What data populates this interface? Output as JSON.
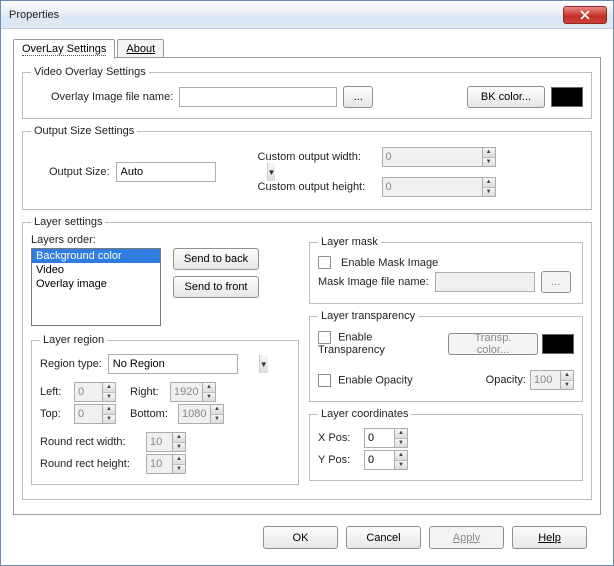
{
  "window": {
    "title": "Properties"
  },
  "tabs": {
    "overlay": "OverLay Settings",
    "about": "About"
  },
  "video_overlay": {
    "legend": "Video Overlay Settings",
    "file_label": "Overlay Image file name:",
    "file_value": "",
    "browse": "...",
    "bk_color": "BK color...",
    "bk_color_value": "#000000"
  },
  "output_size": {
    "legend": "Output Size Settings",
    "size_label": "Output Size:",
    "size_value": "Auto",
    "cw_label": "Custom output width:",
    "cw_value": "0",
    "ch_label": "Custom output height:",
    "ch_value": "0"
  },
  "layer_settings": {
    "legend": "Layer settings",
    "order_label": "Layers order:",
    "items": [
      "Background color",
      "Video",
      "Overlay image"
    ],
    "selected_index": 0,
    "send_back": "Send to back",
    "send_front": "Send to front"
  },
  "layer_mask": {
    "legend": "Layer mask",
    "enable": "Enable Mask Image",
    "file_label": "Mask Image file name:",
    "file_value": "",
    "browse": "..."
  },
  "layer_region": {
    "legend": "Layer region",
    "type_label": "Region type:",
    "type_value": "No Region",
    "left_label": "Left:",
    "left_value": "0",
    "right_label": "Right:",
    "right_value": "1920",
    "top_label": "Top:",
    "top_value": "0",
    "bottom_label": "Bottom:",
    "bottom_value": "1080",
    "rrw_label": "Round rect width:",
    "rrw_value": "10",
    "rrh_label": "Round rect height:",
    "rrh_value": "10"
  },
  "layer_transparency": {
    "legend": "Layer transparency",
    "enable_t": "Enable Transparency",
    "transp_color": "Transp. color...",
    "transp_color_value": "#000000",
    "enable_o": "Enable Opacity",
    "opacity_label": "Opacity:",
    "opacity_value": "100"
  },
  "layer_coords": {
    "legend": "Layer coordinates",
    "x_label": "X Pos:",
    "x_value": "0",
    "y_label": "Y Pos:",
    "y_value": "0"
  },
  "footer": {
    "ok": "OK",
    "cancel": "Cancel",
    "apply": "Apply",
    "help": "Help"
  }
}
